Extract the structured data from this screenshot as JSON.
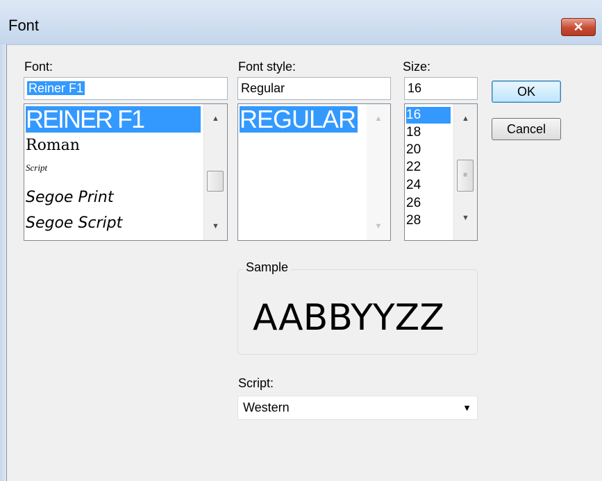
{
  "window": {
    "title": "Font",
    "close_glyph": "✕"
  },
  "font": {
    "label": "Font:",
    "value": "Reiner F1",
    "items": [
      "REINER F1",
      "Roman",
      "Script",
      "Segoe Print",
      "Segoe Script"
    ]
  },
  "style": {
    "label": "Font style:",
    "value": "Regular",
    "items": [
      "REGULAR"
    ]
  },
  "size": {
    "label": "Size:",
    "value": "16",
    "items": [
      "16",
      "18",
      "20",
      "22",
      "24",
      "26",
      "28"
    ]
  },
  "buttons": {
    "ok": "OK",
    "cancel": "Cancel"
  },
  "sample": {
    "label": "Sample",
    "text": "AABBYYZZ"
  },
  "script": {
    "label": "Script:",
    "value": "Western"
  },
  "colors": {
    "selection": "#3399ff",
    "dialog_bg": "#f0f0f0",
    "close_button": "#c84b33"
  },
  "icons": {
    "close": "close-icon",
    "scroll_up": "chevron-up-icon",
    "scroll_down": "chevron-down-icon",
    "combo": "chevron-down-icon"
  }
}
